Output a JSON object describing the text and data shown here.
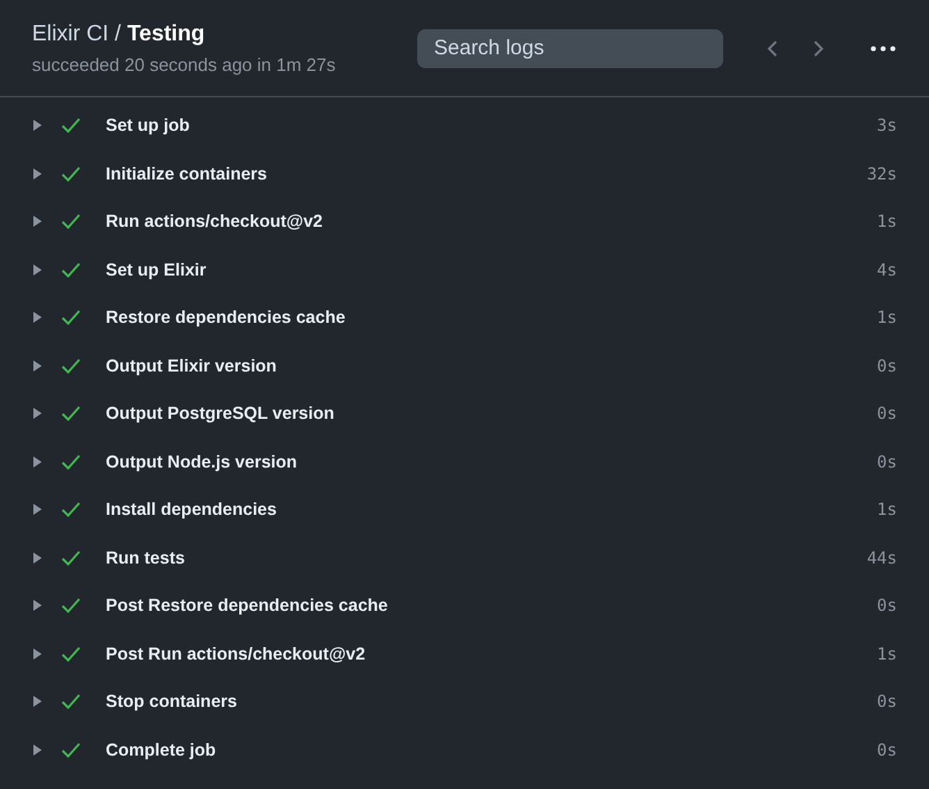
{
  "header": {
    "title": "Elixir CI / **Testing**",
    "subtitle": "succeeded 20 seconds ago in 1m 27s",
    "search": {
      "placeholder": "Search logs"
    }
  },
  "steps": [
    {
      "name": "Set up job",
      "duration": "3s",
      "kind": "success",
      "expanded": false
    },
    {
      "name": "Initialize containers",
      "duration": "32s",
      "kind": "success",
      "expanded": false
    },
    {
      "name": "Run actions/checkout@v2",
      "duration": "1s",
      "kind": "success",
      "expanded": false
    },
    {
      "name": "Set up Elixir",
      "duration": "4s",
      "kind": "success",
      "expanded": false
    },
    {
      "name": "Restore dependencies cache",
      "duration": "1s",
      "kind": "success",
      "expanded": false
    },
    {
      "name": "Output Elixir version",
      "duration": "0s",
      "kind": "success",
      "expanded": false
    },
    {
      "name": "Output PostgreSQL version",
      "duration": "0s",
      "kind": "success",
      "expanded": false
    },
    {
      "name": "Output Node.js version",
      "duration": "0s",
      "kind": "success",
      "expanded": false
    },
    {
      "name": "Install dependencies",
      "duration": "1s",
      "kind": "success",
      "expanded": false
    },
    {
      "name": "Run tests",
      "duration": "44s",
      "kind": "success",
      "expanded": false
    },
    {
      "name": "Post Restore dependencies cache",
      "duration": "0s",
      "kind": "success",
      "expanded": false
    },
    {
      "name": "Post Run actions/checkout@v2",
      "duration": "1s",
      "kind": "success",
      "expanded": false
    },
    {
      "name": "Stop containers",
      "duration": "0s",
      "kind": "success",
      "expanded": false
    },
    {
      "name": "Complete job",
      "duration": "0s",
      "kind": "success",
      "expanded": false
    }
  ]
}
